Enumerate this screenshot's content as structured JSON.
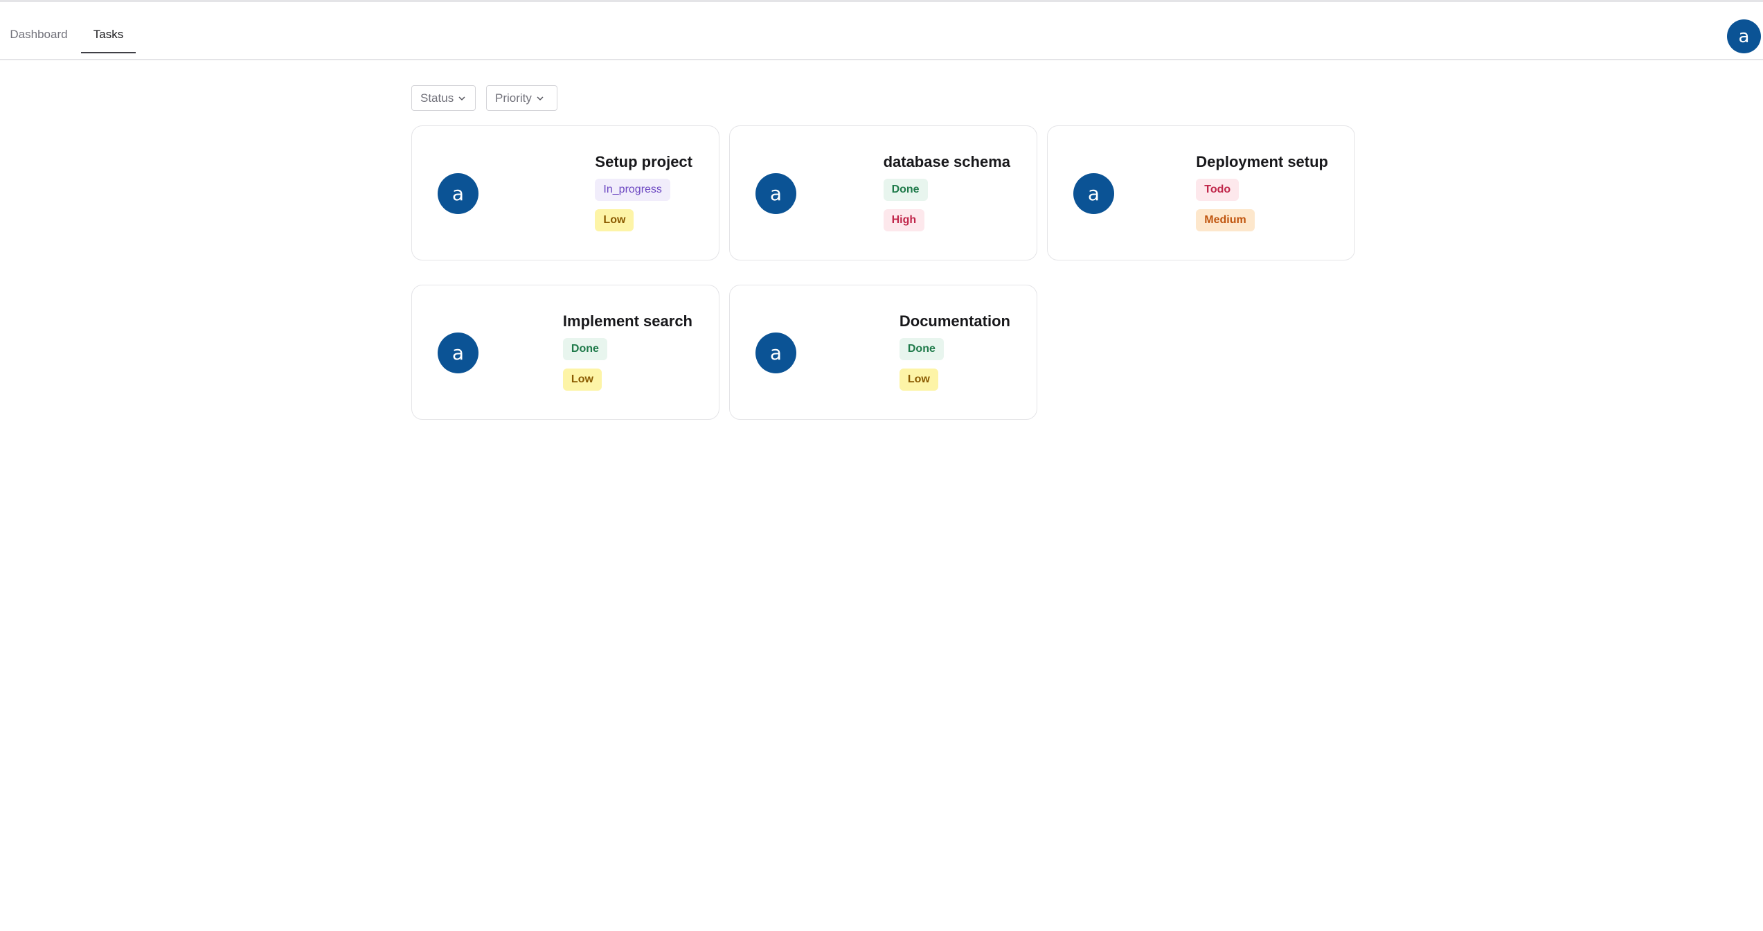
{
  "nav": {
    "tabs": [
      {
        "label": "Dashboard",
        "active": false
      },
      {
        "label": "Tasks",
        "active": true
      }
    ],
    "user_avatar_letter": "a"
  },
  "filters": {
    "status_label": "Status",
    "priority_label": "Priority"
  },
  "colors": {
    "avatar_bg": "#0b5395",
    "in_progress": "#6b46c1",
    "done": "#1f7a4a",
    "todo": "#c0264a",
    "low": "#fdf4a7",
    "high": "#c0264a",
    "medium": "#c0560f"
  },
  "tasks": [
    {
      "title": "Setup project",
      "status": "In_progress",
      "priority": "Low",
      "avatar": "a"
    },
    {
      "title": "database schema",
      "status": "Done",
      "priority": "High",
      "avatar": "a"
    },
    {
      "title": "Deployment setup",
      "status": "Todo",
      "priority": "Medium",
      "avatar": "a"
    },
    {
      "title": "Implement search",
      "status": "Done",
      "priority": "Low",
      "avatar": "a"
    },
    {
      "title": "Documentation",
      "status": "Done",
      "priority": "Low",
      "avatar": "a"
    }
  ]
}
